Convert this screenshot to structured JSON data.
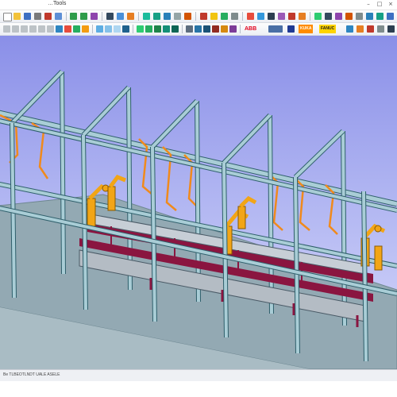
{
  "window": {
    "title": "…Tools",
    "minimize_glyph": "–",
    "maximize_glyph": "□",
    "close_glyph": "×"
  },
  "toolbar": {
    "brands": {
      "abb": "ABB",
      "kuka": "KUKA",
      "fanuc": "FANUC"
    },
    "icons": [
      "new-file-icon",
      "open-icon",
      "save-icon",
      "print-icon",
      "cut-icon",
      "copy-icon",
      "paste-icon",
      "undo-icon",
      "redo-icon",
      "select-icon",
      "move-icon",
      "rotate-icon",
      "zoom-icon",
      "fit-icon",
      "layer-icon",
      "grid-icon",
      "robot-icon",
      "path-icon",
      "weld-icon",
      "simulate-icon",
      "camera-icon",
      "settings-icon",
      "help-icon"
    ]
  },
  "scene": {
    "frame_color": "#a9cdd6",
    "frame_outline": "#2f5f6b",
    "floor_color": "#93a9b3",
    "conveyor_color": "#8a1540",
    "robot_color": "#f2a516",
    "cable_color": "#f08a1c"
  },
  "status": {
    "text": "Be  TLBEOTLNDT UALE ASELE"
  }
}
